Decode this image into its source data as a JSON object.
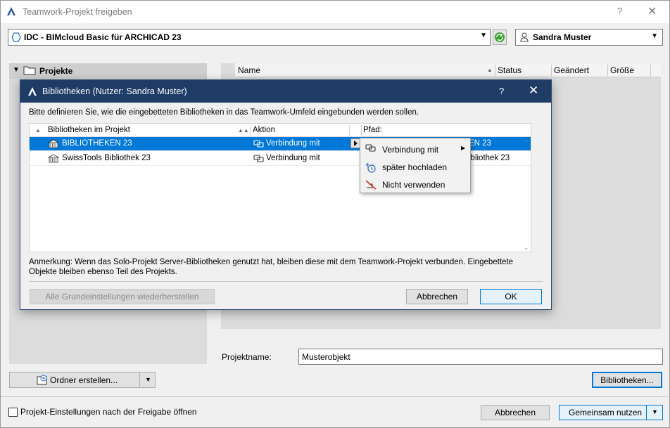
{
  "window": {
    "title": "Teamwork-Projekt freigeben",
    "help": "?",
    "close": "✕"
  },
  "server_select": {
    "value": "IDC - BIMcloud Basic für ARCHICAD 23"
  },
  "user_select": {
    "value": "Sandra Muster"
  },
  "left_panel": {
    "root_label": "Projekte"
  },
  "project_list": {
    "columns": [
      "Name",
      "Status",
      "Geändert",
      "Größe"
    ]
  },
  "project_name": {
    "label": "Projektname:",
    "value": "Musterobjekt"
  },
  "folder_button": {
    "label": "Ordner erstellen..."
  },
  "libraries_button": {
    "label": "Bibliotheken..."
  },
  "open_settings": {
    "label": "Projekt-Einstellungen nach der Freigabe öffnen",
    "checked": false
  },
  "footer": {
    "cancel_label": "Abbrechen",
    "share_label": "Gemeinsam nutzen"
  },
  "dialog": {
    "title": "Bibliotheken (Nutzer: Sandra Muster)",
    "help": "?",
    "close": "✕",
    "instruction": "Bitte definieren Sie, wie die eingebetteten Bibliotheken in das Teamwork-Umfeld eingebunden werden sollen.",
    "columns": {
      "library": "Bibliotheken im Projekt",
      "action": "Aktion",
      "path": "Pfad:"
    },
    "rows": [
      {
        "name": "BIBLIOTHEKEN 23",
        "action": "Verbindung mit",
        "path": "EN 23",
        "selected": true
      },
      {
        "name": "SwissTools Bibliothek 23",
        "action": "Verbindung mit",
        "path": "ibliothek 23",
        "selected": false
      }
    ],
    "note": "Anmerkung: Wenn das Solo-Projekt Server-Bibliotheken genutzt hat, bleiben diese mit dem Teamwork-Projekt verbunden. Eingebettete Objekte bleiben ebenso Teil des Projekts.",
    "reset_label": "Alle Grundeinstellungen wiederherstellen",
    "cancel_label": "Abbrechen",
    "ok_label": "OK"
  },
  "context_menu": {
    "items": [
      {
        "label": "Verbindung mit",
        "icon": "link-icon",
        "has_submenu": true
      },
      {
        "label": "später hochladen",
        "icon": "upload-later-icon",
        "has_submenu": false
      },
      {
        "label": "Nicht verwenden",
        "icon": "do-not-use-icon",
        "has_submenu": false
      }
    ]
  },
  "colors": {
    "dialog_titlebar": "#1f3c67",
    "selection": "#0078d7",
    "default_button_border": "#0078d7"
  }
}
